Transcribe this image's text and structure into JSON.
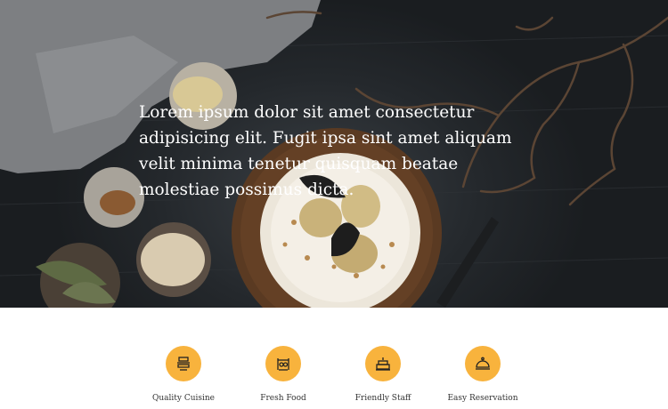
{
  "hero": {
    "text": "Lorem ipsum dolor sit amet consectetur adipisicing elit. Fugit ipsa sint amet aliquam velit minima tenetur quisquam beatae molestiae possimus dicta."
  },
  "features": [
    {
      "label": "Quality Cuisine",
      "icon": "dish-icon"
    },
    {
      "label": "Fresh Food",
      "icon": "market-stall-icon"
    },
    {
      "label": "Friendly Staff",
      "icon": "cake-icon"
    },
    {
      "label": "Easy Reservation",
      "icon": "cloche-icon"
    }
  ],
  "colors": {
    "accent": "#f8b33d",
    "hero_text": "#ffffff",
    "label_text": "#333333"
  }
}
